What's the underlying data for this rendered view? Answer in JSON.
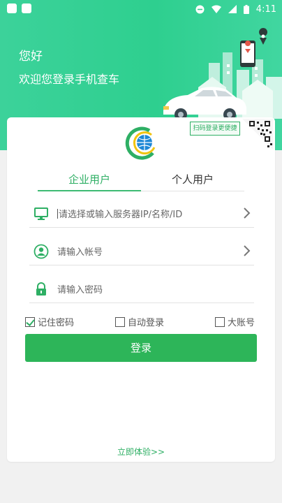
{
  "status_bar": {
    "time": "4:11"
  },
  "header": {
    "greeting": "您好",
    "subtitle": "欢迎您登录手机查车"
  },
  "card": {
    "qr_tag": "扫码登录更便捷",
    "tabs": [
      {
        "label": "企业用户",
        "active": true
      },
      {
        "label": "个人用户",
        "active": false
      }
    ],
    "fields": {
      "server": {
        "placeholder": "请选择或输入服务器IP/名称/ID",
        "icon": "monitor-icon"
      },
      "account": {
        "placeholder": "请输入帐号",
        "icon": "user-icon"
      },
      "password": {
        "placeholder": "请输入密码",
        "icon": "lock-icon"
      }
    },
    "options": {
      "remember": {
        "label": "记住密码",
        "checked": true
      },
      "auto_login": {
        "label": "自动登录",
        "checked": false
      },
      "big_account": {
        "label": "大账号",
        "checked": false
      }
    },
    "login_button": "登录",
    "try_link": "立即体验>>"
  },
  "colors": {
    "accent": "#2db559",
    "header": "#33d095"
  }
}
